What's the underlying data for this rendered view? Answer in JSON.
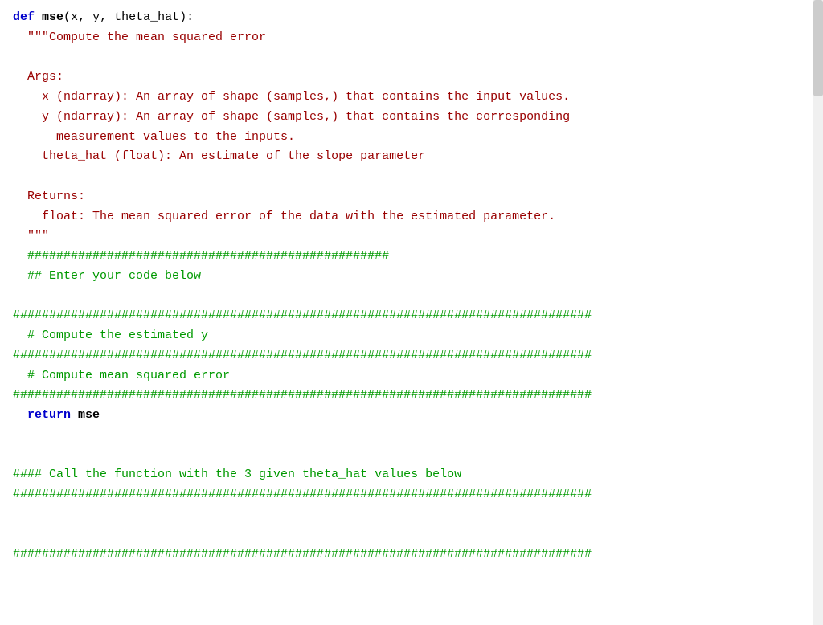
{
  "code": {
    "lines": [
      {
        "id": "line1",
        "type": "def",
        "content": "def mse(x, y, theta_hat):"
      },
      {
        "id": "line2",
        "type": "docstring",
        "content": "  \"\"\"Compute the mean squared error"
      },
      {
        "id": "line3",
        "type": "docstring",
        "content": ""
      },
      {
        "id": "line4",
        "type": "docstring",
        "content": "  Args:"
      },
      {
        "id": "line5",
        "type": "docstring",
        "content": "    x (ndarray): An array of shape (samples,) that contains the input values."
      },
      {
        "id": "line6",
        "type": "docstring",
        "content": "    y (ndarray): An array of shape (samples,) that contains the corresponding"
      },
      {
        "id": "line7",
        "type": "docstring",
        "content": "      measurement values to the inputs."
      },
      {
        "id": "line8",
        "type": "docstring",
        "content": "    theta_hat (float): An estimate of the slope parameter"
      },
      {
        "id": "line9",
        "type": "docstring",
        "content": ""
      },
      {
        "id": "line10",
        "type": "docstring",
        "content": "  Returns:"
      },
      {
        "id": "line11",
        "type": "docstring",
        "content": "    float: The mean squared error of the data with the estimated parameter."
      },
      {
        "id": "line12",
        "type": "docstring",
        "content": "  \"\"\""
      },
      {
        "id": "line13",
        "type": "comment",
        "content": "  ##################################################"
      },
      {
        "id": "line14",
        "type": "comment",
        "content": "  ## Enter your code below"
      },
      {
        "id": "line15",
        "type": "blank",
        "content": ""
      },
      {
        "id": "line16",
        "type": "hash",
        "content": "################################################################################"
      },
      {
        "id": "line17",
        "type": "comment",
        "content": "  # Compute the estimated y"
      },
      {
        "id": "line18",
        "type": "hash",
        "content": "################################################################################"
      },
      {
        "id": "line19",
        "type": "comment",
        "content": "  # Compute mean squared error"
      },
      {
        "id": "line20",
        "type": "hash",
        "content": "################################################################################"
      },
      {
        "id": "line21",
        "type": "return",
        "content": "  return mse"
      },
      {
        "id": "line22",
        "type": "blank",
        "content": ""
      },
      {
        "id": "line23",
        "type": "blank",
        "content": ""
      },
      {
        "id": "line24",
        "type": "comment4hash",
        "content": "#### Call the function with the 3 given theta_hat values below"
      },
      {
        "id": "line25",
        "type": "hash",
        "content": "################################################################################"
      },
      {
        "id": "line26",
        "type": "blank",
        "content": ""
      },
      {
        "id": "line27",
        "type": "blank",
        "content": ""
      },
      {
        "id": "line28",
        "type": "hash",
        "content": "################################################################################"
      }
    ]
  }
}
